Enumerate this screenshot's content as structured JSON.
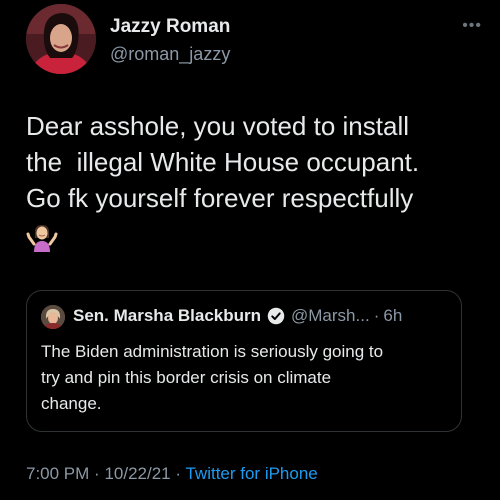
{
  "author": {
    "name": "Jazzy Roman",
    "handle": "@roman_jazzy"
  },
  "more_icon": "more-horizontal-icon",
  "tweet": {
    "lines": [
      "Dear asshole, you voted to install",
      "the  illegal White House occupant.",
      "Go fk yourself forever respectfully"
    ],
    "emoji": "woman-shrugging"
  },
  "quoted_tweet": {
    "name": "Sen. Marsha Blackburn",
    "handle": "@Marsh...",
    "separator": "·",
    "time": "6h",
    "verified_icon": "verified-badge-icon",
    "lines": [
      "The Biden administration is seriously going to",
      "try and pin this border crisis on climate",
      "change."
    ]
  },
  "meta": {
    "time": "7:00 PM",
    "separator1": "·",
    "date": "10/22/21",
    "separator2": "·",
    "source": "Twitter for iPhone"
  },
  "colors": {
    "background": "#000000",
    "text": "#e7e9ea",
    "secondary": "#8b98a5",
    "link": "#1d9bf0",
    "border": "#2f3336"
  }
}
